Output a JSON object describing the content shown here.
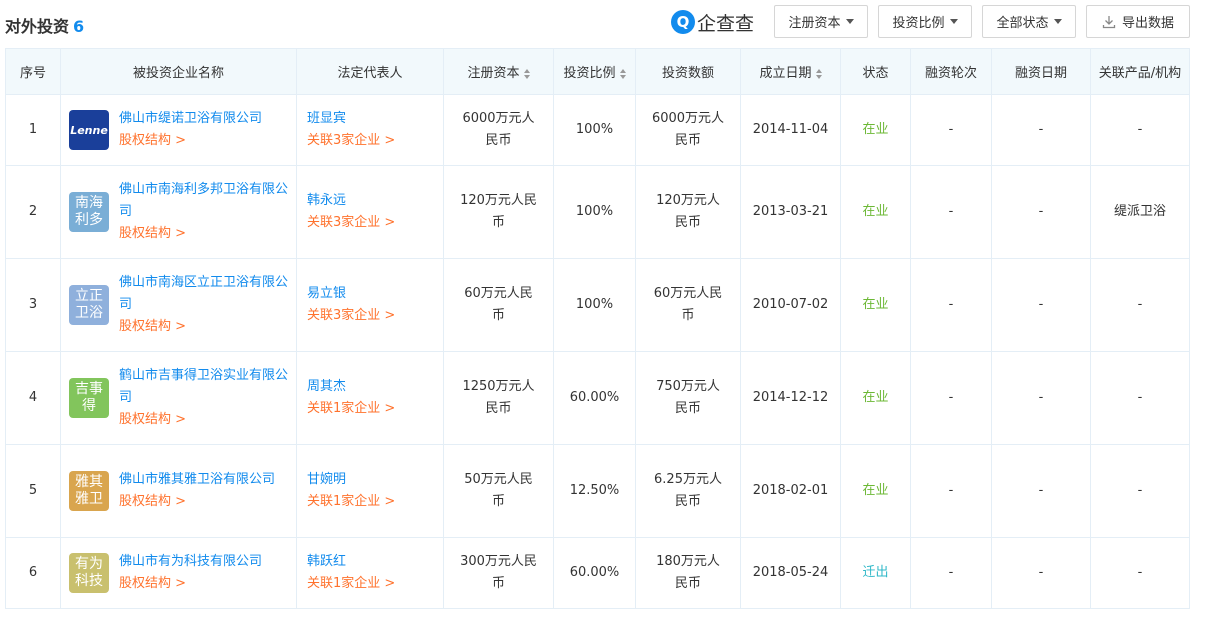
{
  "header": {
    "title": "对外投资",
    "count": "6",
    "logo_mark": "Q",
    "logo_text": "企查查",
    "buttons": {
      "capital": "注册资本",
      "ratio": "投资比例",
      "status": "全部状态",
      "export": "导出数据"
    }
  },
  "table": {
    "columns": [
      "序号",
      "被投资企业名称",
      "法定代表人",
      "注册资本",
      "投资比例",
      "投资数额",
      "成立日期",
      "状态",
      "融资轮次",
      "融资日期",
      "关联产品/机构"
    ],
    "rows": [
      {
        "idx": "1",
        "avatar": "Lenne",
        "avatar_color": "#1a3f9a",
        "name": "佛山市缇诺卫浴有限公司",
        "sub": "股权结构 >",
        "rep": "班显宾",
        "rep_link": "关联3家企业 >",
        "capital": "6000万元人民币",
        "ratio": "100%",
        "amount": "6000万元人民币",
        "date": "2014-11-04",
        "status": "在业",
        "status_color": "#6cb835",
        "round": "-",
        "fin_date": "-",
        "product": "-"
      },
      {
        "idx": "2",
        "avatar": "南海利多",
        "avatar_color": "#7aaed6",
        "name": "佛山市南海利多邦卫浴有限公司",
        "sub": "股权结构 >",
        "rep": "韩永远",
        "rep_link": "关联3家企业 >",
        "capital": "120万元人民币",
        "ratio": "100%",
        "amount": "120万元人民币",
        "date": "2013-03-21",
        "status": "在业",
        "status_color": "#6cb835",
        "round": "-",
        "fin_date": "-",
        "product": "缇派卫浴"
      },
      {
        "idx": "3",
        "avatar": "立正卫浴",
        "avatar_color": "#8fb0dc",
        "name": "佛山市南海区立正卫浴有限公司",
        "sub": "股权结构 >",
        "rep": "易立银",
        "rep_link": "关联3家企业 >",
        "capital": "60万元人民币",
        "ratio": "100%",
        "amount": "60万元人民币",
        "date": "2010-07-02",
        "status": "在业",
        "status_color": "#6cb835",
        "round": "-",
        "fin_date": "-",
        "product": "-"
      },
      {
        "idx": "4",
        "avatar": "吉事得",
        "avatar_color": "#82c55c",
        "name": "鹤山市吉事得卫浴实业有限公司",
        "sub": "股权结构 >",
        "rep": "周其杰",
        "rep_link": "关联1家企业 >",
        "capital": "1250万元人民币",
        "ratio": "60.00%",
        "amount": "750万元人民币",
        "date": "2014-12-12",
        "status": "在业",
        "status_color": "#6cb835",
        "round": "-",
        "fin_date": "-",
        "product": "-"
      },
      {
        "idx": "5",
        "avatar": "雅其雅卫",
        "avatar_color": "#d9a54e",
        "name": "佛山市雅其雅卫浴有限公司",
        "sub": "股权结构 >",
        "rep": "甘婉明",
        "rep_link": "关联1家企业 >",
        "capital": "50万元人民币",
        "ratio": "12.50%",
        "amount": "6.25万元人民币",
        "date": "2018-02-01",
        "status": "在业",
        "status_color": "#6cb835",
        "round": "-",
        "fin_date": "-",
        "product": "-"
      },
      {
        "idx": "6",
        "avatar": "有为科技",
        "avatar_color": "#c9c06e",
        "name": "佛山市有为科技有限公司",
        "sub": "股权结构 >",
        "rep": "韩跃红",
        "rep_link": "关联1家企业 >",
        "capital": "300万元人民币",
        "ratio": "60.00%",
        "amount": "180万元人民币",
        "date": "2018-05-24",
        "status": "迁出",
        "status_color": "#2fb8c8",
        "round": "-",
        "fin_date": "-",
        "product": "-"
      }
    ]
  }
}
